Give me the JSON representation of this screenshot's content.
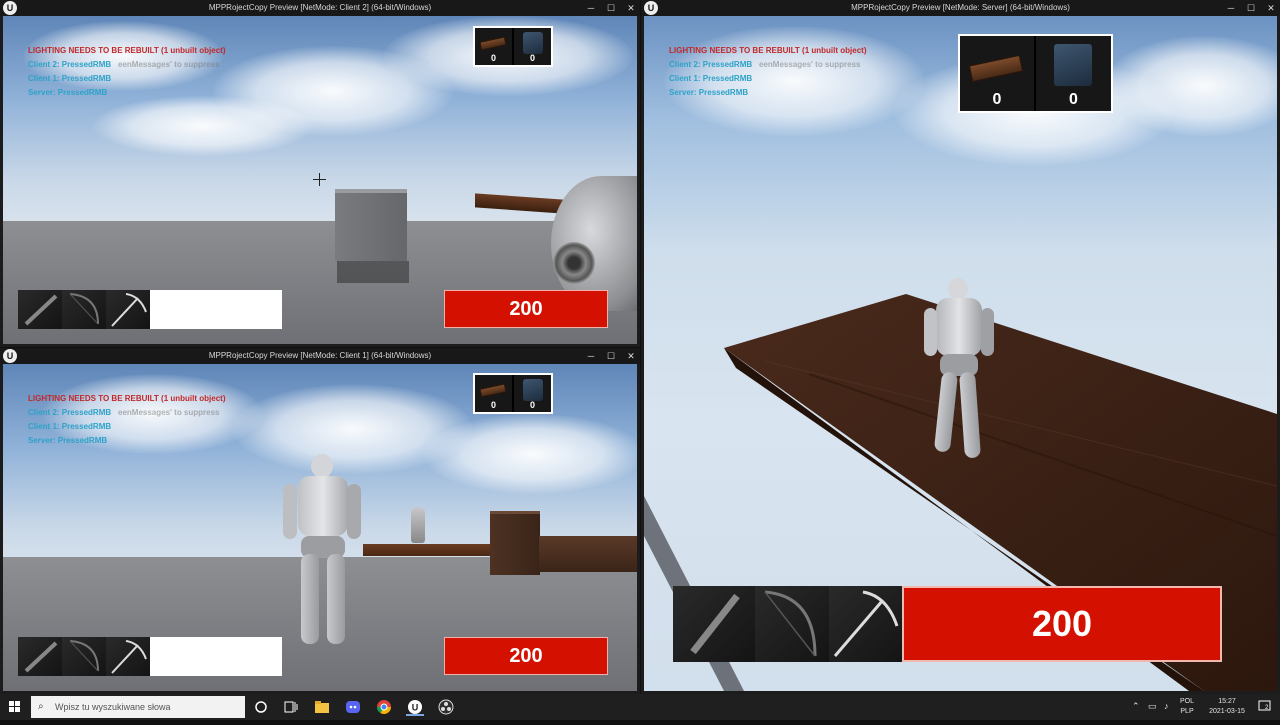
{
  "windows": {
    "client2": {
      "title": "MPPRojectCopy Preview [NetMode: Client 2]  (64-bit/Windows)"
    },
    "client1": {
      "title": "MPPRojectCopy Preview [NetMode: Client 1]  (64-bit/Windows)"
    },
    "server": {
      "title": "MPPRojectCopy Preview [NetMode: Server]  (64-bit/Windows)"
    }
  },
  "title_controls": {
    "minimize": "─",
    "maximize": "☐",
    "close": "✕"
  },
  "debug": {
    "lighting": "LIGHTING NEEDS TO BE REBUILT (1 unbuilt object)",
    "ghost": "eenMessages' to suppress",
    "client2": "Client 2: PressedRMB",
    "client1": "Client 1: PressedRMB",
    "server": "Server: PressedRMB"
  },
  "inventory": {
    "wood_count": "0",
    "stone_count": "0"
  },
  "hud": {
    "health": "200"
  },
  "taskbar": {
    "search_placeholder": "Wpisz tu wyszukiwane słowa",
    "language": "POL",
    "layout": "PLP",
    "time": "15:27",
    "date": "2021-03-15",
    "notification_count": "2"
  },
  "colors": {
    "health_bar": "#d41000",
    "lighting_warning": "#c2282a",
    "debug_message": "#2ea2c8"
  },
  "icons": [
    "unreal-engine-icon",
    "sword-icon",
    "bow-icon",
    "pickaxe-icon",
    "plank-icon",
    "stone-icon",
    "windows-start-icon",
    "search-icon",
    "cortana-icon",
    "task-view-icon",
    "file-explorer-icon",
    "discord-icon",
    "chrome-icon",
    "obs-icon"
  ]
}
